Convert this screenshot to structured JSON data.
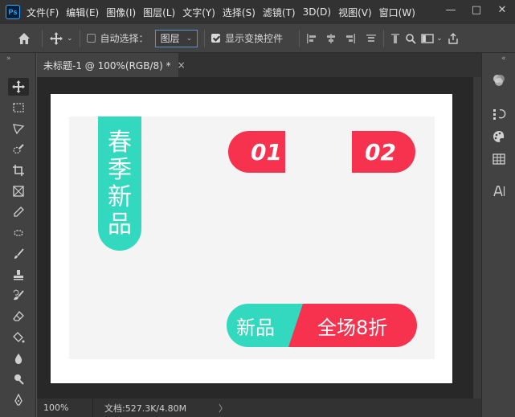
{
  "app": {
    "logo": "Ps",
    "menu": [
      "文件(F)",
      "编辑(E)",
      "图像(I)",
      "图层(L)",
      "文字(Y)",
      "选择(S)",
      "滤镜(T)",
      "3D(D)",
      "视图(V)",
      "窗口(W)"
    ],
    "window_controls": {
      "minimize": "—",
      "maximize": "□",
      "close": "✕"
    }
  },
  "options_bar": {
    "auto_select_label": "自动选择：",
    "auto_select_checked": false,
    "target_value": "图层",
    "show_transform_label": "显示变换控件",
    "show_transform_checked": true
  },
  "document": {
    "tab_title": "未标题-1 @ 100%(RGB/8) *",
    "tab_close": "×"
  },
  "canvas": {
    "vertical_tag": [
      "春",
      "季",
      "新",
      "品"
    ],
    "badge_one": "01",
    "badge_two": "02",
    "promo_left": "新品",
    "promo_right": "全场8折",
    "colors": {
      "teal": "#33d9bf",
      "red": "#f7324e"
    }
  },
  "status": {
    "zoom": "100%",
    "doc_info": "文档:527.3K/4.80M",
    "arrow": "〉"
  },
  "icons": {
    "left_tools": [
      "move-icon",
      "marquee-icon",
      "lasso-icon",
      "quick-select-icon",
      "crop-icon",
      "frame-icon",
      "eyedropper-icon",
      "healing-icon",
      "brush-icon",
      "stamp-icon",
      "history-brush-icon",
      "eraser-icon",
      "paint-bucket-icon",
      "blur-icon",
      "dodge-icon",
      "pen-icon"
    ],
    "right_tools": [
      "color-icon",
      "history-icon",
      "swatches-icon",
      "grid-icon",
      "character-icon"
    ]
  }
}
